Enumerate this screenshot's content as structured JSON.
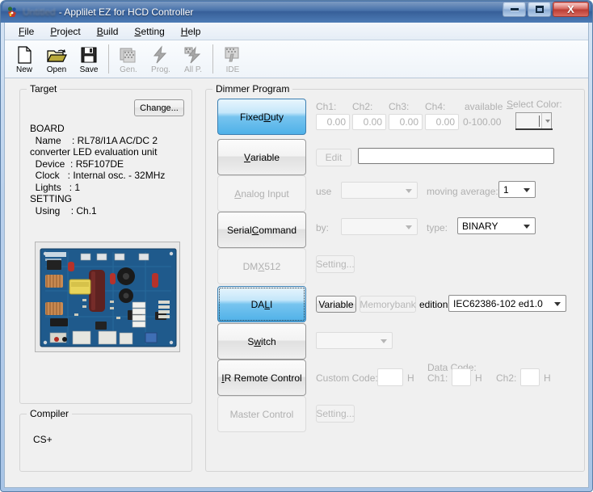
{
  "window": {
    "title_redacted": "Untitled",
    "title": "- Applilet EZ for HCD Controller",
    "app_icon": "applilet-icon",
    "minimize_label": "Minimize",
    "maximize_label": "Maximize",
    "close_label": "X"
  },
  "menu": [
    {
      "label": "File",
      "accel": "F"
    },
    {
      "label": "Project",
      "accel": "P"
    },
    {
      "label": "Build",
      "accel": "B"
    },
    {
      "label": "Setting",
      "accel": "S"
    },
    {
      "label": "Help",
      "accel": "H"
    }
  ],
  "toolbar": [
    {
      "label": "New",
      "icon": "new-document-icon",
      "enabled": true
    },
    {
      "label": "Open",
      "icon": "open-folder-icon",
      "enabled": true
    },
    {
      "label": "Save",
      "icon": "floppy-disk-icon",
      "enabled": true
    },
    {
      "label": "Gen.",
      "icon": "generate-icon",
      "enabled": false
    },
    {
      "label": "Prog.",
      "icon": "program-flash-icon",
      "enabled": false
    },
    {
      "label": "All P.",
      "icon": "all-program-icon",
      "enabled": false
    },
    {
      "label": "IDE",
      "icon": "ide-icon",
      "enabled": false
    }
  ],
  "target": {
    "legend": "Target",
    "change_button": "Change...",
    "info": "BOARD\n  Name    : RL78/I1A AC/DC 2\nconverter LED evaluation unit\n  Device  : R5F107DE\n  Clock   : Internal osc. - 32MHz\n  Lights   : 1\nSETTING\n  Using    : Ch.1",
    "photo_alt": "RL78/I1A AC/DC LED evaluation board photo"
  },
  "compiler": {
    "legend": "Compiler",
    "value": "CS+"
  },
  "dimmer": {
    "legend": "Dimmer Program",
    "modes": [
      {
        "label": "Fixed Duty",
        "accel": "D",
        "state": "selected"
      },
      {
        "label": "Variable",
        "accel": "V",
        "state": "normal"
      },
      {
        "label": "Analog Input",
        "accel": "A",
        "state": "disabled"
      },
      {
        "label": "Serial Command",
        "accel": "C",
        "state": "normal"
      },
      {
        "label": "DMX512",
        "accel": "X",
        "state": "disabled"
      },
      {
        "label": "DALI",
        "accel": "I",
        "state": "selected-focused"
      },
      {
        "label": "Switch",
        "accel": "w",
        "state": "normal"
      },
      {
        "label": "IR Remote Control",
        "accel": "I",
        "state": "normal"
      },
      {
        "label": "Master Control",
        "accel": "",
        "state": "disabled"
      }
    ],
    "fixed_duty": {
      "channels": [
        {
          "label": "Ch1:",
          "value": "0.00"
        },
        {
          "label": "Ch2:",
          "value": "0.00"
        },
        {
          "label": "Ch3:",
          "value": "0.00"
        },
        {
          "label": "Ch4:",
          "value": "0.00"
        }
      ],
      "available_label": "available",
      "available_range": "0-100.00",
      "select_color_label": "Select Color:",
      "select_color_accel": "S",
      "select_color_value": ""
    },
    "variable": {
      "edit_button": "Edit",
      "path_value": ""
    },
    "analog": {
      "use_label": "use",
      "use_value": "",
      "moving_average_label": "moving average:",
      "moving_average_value": "1"
    },
    "serial": {
      "by_label": "by:",
      "by_value": "",
      "type_label": "type:",
      "type_value": "BINARY"
    },
    "dmx512": {
      "setting_button": "Setting..."
    },
    "dali": {
      "variable_button": "Variable",
      "memorybank_button": "Memorybank",
      "edition_label": "edition:",
      "edition_value": "IEC62386-102 ed1.0"
    },
    "switch": {
      "value": ""
    },
    "ir_remote": {
      "custom_code_label": "Custom Code:",
      "custom_code_value": "",
      "custom_code_unit": "H",
      "data_code_label": "Data Code:",
      "ch1_label": "Ch1:",
      "ch1_value": "",
      "ch1_unit": "H",
      "ch2_label": "Ch2:",
      "ch2_value": "",
      "ch2_unit": "H"
    },
    "master": {
      "setting_button": "Setting..."
    }
  }
}
